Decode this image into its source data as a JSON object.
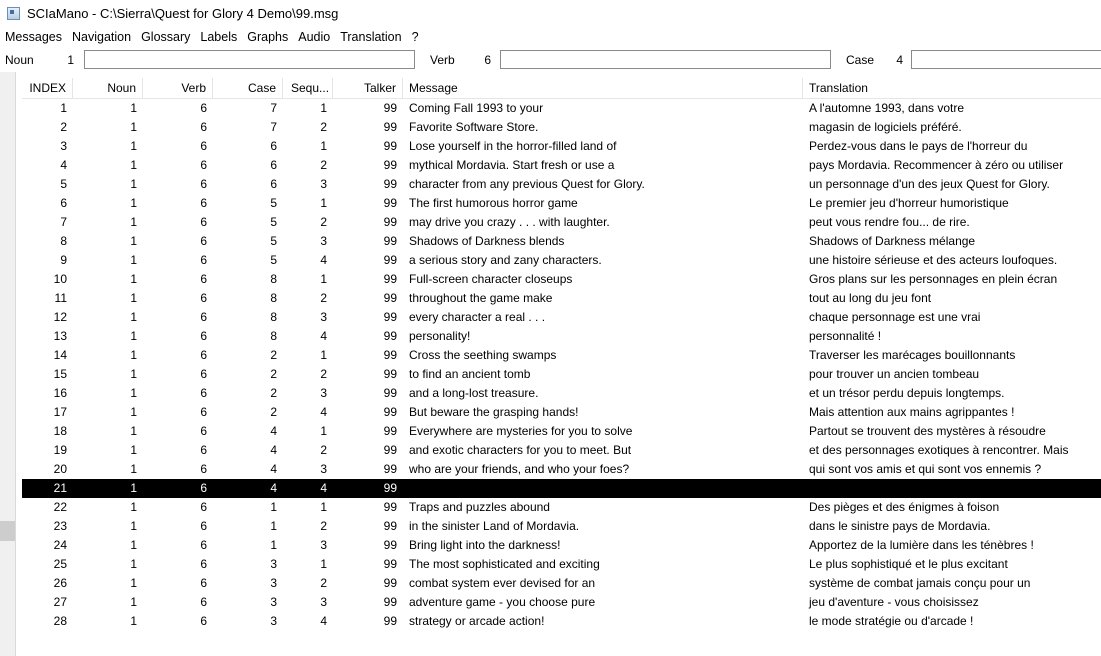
{
  "window": {
    "title": "SCIaMano - C:\\Sierra\\Quest for Glory 4 Demo\\99.msg"
  },
  "menu": [
    "Messages",
    "Navigation",
    "Glossary",
    "Labels",
    "Graphs",
    "Audio",
    "Translation",
    "?"
  ],
  "filters": {
    "noun_label": "Noun",
    "noun_value": "1",
    "verb_label": "Verb",
    "verb_value": "6",
    "case_label": "Case",
    "case_value": "4"
  },
  "table": {
    "headers": [
      "INDEX",
      "Noun",
      "Verb",
      "Case",
      "Sequ...",
      "Talker",
      "Message",
      "Translation"
    ],
    "selected_index": 20,
    "rows": [
      [
        "1",
        "1",
        "6",
        "7",
        "1",
        "99",
        "Coming Fall 1993 to your",
        "A l'automne 1993, dans votre"
      ],
      [
        "2",
        "1",
        "6",
        "7",
        "2",
        "99",
        "Favorite Software Store.",
        "magasin de logiciels préféré."
      ],
      [
        "3",
        "1",
        "6",
        "6",
        "1",
        "99",
        "Lose yourself in the horror-filled land of",
        "Perdez-vous dans le pays de l'horreur du"
      ],
      [
        "4",
        "1",
        "6",
        "6",
        "2",
        "99",
        "mythical Mordavia.  Start fresh or use a",
        "pays Mordavia. Recommencer à zéro ou utiliser"
      ],
      [
        "5",
        "1",
        "6",
        "6",
        "3",
        "99",
        "character from any previous Quest for Glory.",
        "un personnage d'un des jeux Quest for Glory."
      ],
      [
        "6",
        "1",
        "6",
        "5",
        "1",
        "99",
        "The first humorous horror game",
        "Le premier jeu d'horreur humoristique"
      ],
      [
        "7",
        "1",
        "6",
        "5",
        "2",
        "99",
        "may drive you crazy . . .  with laughter.",
        "peut vous rendre fou... de rire."
      ],
      [
        "8",
        "1",
        "6",
        "5",
        "3",
        "99",
        "Shadows of Darkness blends",
        "Shadows of Darkness mélange"
      ],
      [
        "9",
        "1",
        "6",
        "5",
        "4",
        "99",
        "a serious story and zany characters.",
        "une histoire sérieuse et des acteurs loufoques."
      ],
      [
        "10",
        "1",
        "6",
        "8",
        "1",
        "99",
        "Full-screen character closeups",
        "Gros plans sur les personnages en plein écran"
      ],
      [
        "11",
        "1",
        "6",
        "8",
        "2",
        "99",
        "throughout the game make",
        "tout au long du jeu font"
      ],
      [
        "12",
        "1",
        "6",
        "8",
        "3",
        "99",
        "every character a real . . .",
        "chaque personnage est une vrai"
      ],
      [
        "13",
        "1",
        "6",
        "8",
        "4",
        "99",
        "personality!",
        "personnalité !"
      ],
      [
        "14",
        "1",
        "6",
        "2",
        "1",
        "99",
        "Cross the seething swamps",
        "Traverser les marécages bouillonnants"
      ],
      [
        "15",
        "1",
        "6",
        "2",
        "2",
        "99",
        "to find an ancient tomb",
        "pour trouver un ancien tombeau"
      ],
      [
        "16",
        "1",
        "6",
        "2",
        "3",
        "99",
        "and a long-lost treasure.",
        "et un trésor perdu depuis longtemps."
      ],
      [
        "17",
        "1",
        "6",
        "2",
        "4",
        "99",
        "But beware the grasping hands!",
        "Mais attention aux mains agrippantes !"
      ],
      [
        "18",
        "1",
        "6",
        "4",
        "1",
        "99",
        "Everywhere are mysteries for you to solve",
        "Partout se trouvent des mystères à résoudre"
      ],
      [
        "19",
        "1",
        "6",
        "4",
        "2",
        "99",
        "and exotic characters for you to meet.  But",
        "et des personnages exotiques à rencontrer. Mais"
      ],
      [
        "20",
        "1",
        "6",
        "4",
        "3",
        "99",
        "who are your friends, and who your foes?",
        "qui sont vos amis et qui sont vos ennemis ?"
      ],
      [
        "21",
        "1",
        "6",
        "4",
        "4",
        "99",
        "",
        ""
      ],
      [
        "22",
        "1",
        "6",
        "1",
        "1",
        "99",
        "Traps and puzzles abound",
        "Des pièges et des énigmes à foison"
      ],
      [
        "23",
        "1",
        "6",
        "1",
        "2",
        "99",
        "in the sinister Land of Mordavia.",
        "dans le sinistre pays de Mordavia."
      ],
      [
        "24",
        "1",
        "6",
        "1",
        "3",
        "99",
        "Bring light into the darkness!",
        "Apportez de la lumière dans les ténèbres !"
      ],
      [
        "25",
        "1",
        "6",
        "3",
        "1",
        "99",
        "The most sophisticated and exciting",
        "Le plus sophistiqué et le plus excitant"
      ],
      [
        "26",
        "1",
        "6",
        "3",
        "2",
        "99",
        "combat system ever devised for an",
        "système de combat jamais conçu pour un"
      ],
      [
        "27",
        "1",
        "6",
        "3",
        "3",
        "99",
        "adventure game - you choose pure",
        "jeu d'aventure - vous choisissez"
      ],
      [
        "28",
        "1",
        "6",
        "3",
        "4",
        "99",
        "strategy or arcade action!",
        "le mode stratégie ou d'arcade !"
      ]
    ]
  }
}
